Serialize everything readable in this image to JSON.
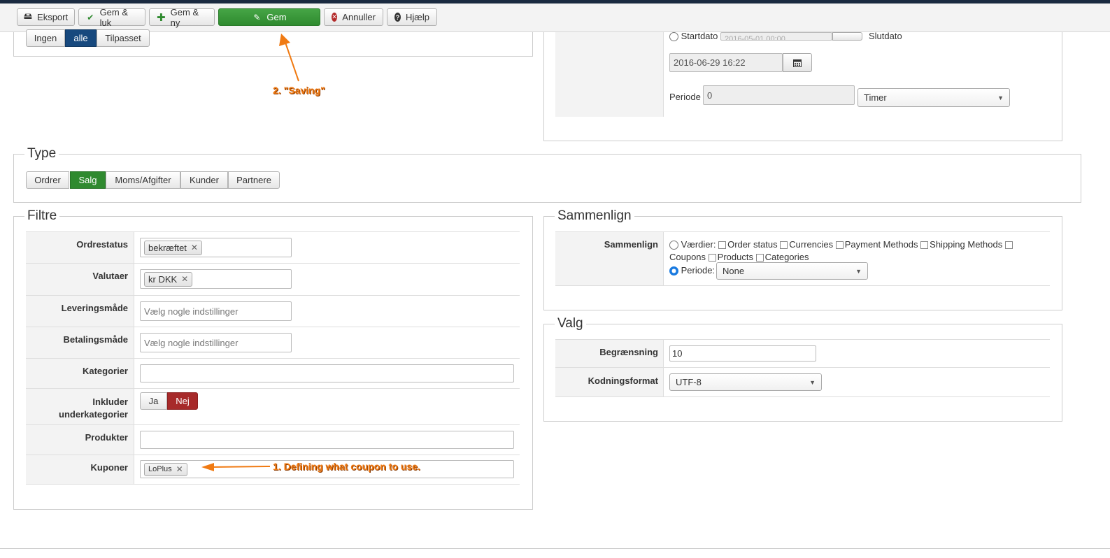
{
  "toolbar": {
    "export": "Eksport",
    "save_close": "Gem & luk",
    "save_new": "Gem & ny",
    "save": "Gem",
    "cancel": "Annuller",
    "help": "Hjælp"
  },
  "top_segment": {
    "none": "Ingen",
    "all": "alle",
    "custom": "Tilpasset"
  },
  "date_panel": {
    "start_label": "Startdato",
    "start_value": "2016-05-01 00:00",
    "end_label": "Slutdato",
    "end_value": "2016-06-29 16:22",
    "period_label": "Periode",
    "period_value": "0",
    "period_unit": "Timer"
  },
  "type": {
    "legend": "Type",
    "buttons": [
      "Ordrer",
      "Salg",
      "Moms/Afgifter",
      "Kunder",
      "Partnere"
    ],
    "active": "Salg"
  },
  "filters": {
    "legend": "Filtre",
    "order_status_label": "Ordrestatus",
    "order_status_tag": "bekræftet",
    "currencies_label": "Valutaer",
    "currencies_tag": "kr DKK",
    "shipping_label": "Leveringsmåde",
    "shipping_placeholder": "Vælg nogle indstillinger",
    "payment_label": "Betalingsmåde",
    "payment_placeholder": "Vælg nogle indstillinger",
    "categories_label": "Kategorier",
    "include_sub_label_1": "Inkluder",
    "include_sub_label_2": "underkategorier",
    "yes": "Ja",
    "no": "Nej",
    "products_label": "Produkter",
    "coupons_label": "Kuponer",
    "coupons_tag": "LoPlus"
  },
  "compare": {
    "legend": "Sammenlign",
    "label": "Sammenlign",
    "values_label": "Værdier:",
    "opts": [
      "Order status",
      "Currencies",
      "Payment Methods",
      "Shipping Methods",
      "Coupons",
      "Products",
      "Categories"
    ],
    "period_label": "Periode:",
    "period_value": "None"
  },
  "options": {
    "legend": "Valg",
    "limit_label": "Begrænsning",
    "limit_value": "10",
    "encoding_label": "Kodningsformat",
    "encoding_value": "UTF-8"
  },
  "annotations": {
    "saving": "2. \"Saving\"",
    "coupon": "1. Defining what coupon to use."
  },
  "colors": {
    "accent_orange": "#f07a12",
    "save_green": "#2f8a2f",
    "active_blue": "#17497e",
    "no_red": "#a72a2a"
  }
}
